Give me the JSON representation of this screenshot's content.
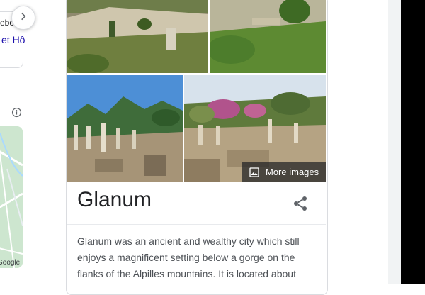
{
  "left_panel": {
    "text_line1": "ebo",
    "text_line2": "et Hô",
    "next_icon": "chevron-right-icon",
    "info_icon": "info-icon",
    "map_label": "Google",
    "map_colors": {
      "land": "#cde6cf",
      "roads": "#ffffff",
      "water": "#aadaff"
    }
  },
  "images": [
    {
      "name": "ruins-aerial-view"
    },
    {
      "name": "ruins-hillside-view"
    },
    {
      "name": "columns-and-mountains"
    },
    {
      "name": "ruins-with-blossoming-trees"
    }
  ],
  "more_images": {
    "label": "More images",
    "icon": "image-gallery-icon"
  },
  "entity": {
    "title": "Glanum",
    "share_icon": "share-icon",
    "description": "Glanum was an ancient and wealthy city which still enjoys a magnificent setting below a gorge on the flanks of the Alpilles mountains. It is located about"
  },
  "colors": {
    "text_primary": "#202124",
    "text_secondary": "#4d5156",
    "link": "#1a0dab",
    "border": "#dadce0"
  }
}
